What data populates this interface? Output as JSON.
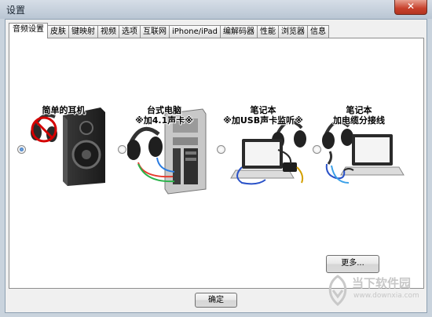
{
  "window": {
    "title": "设置",
    "close_glyph": "✕"
  },
  "tabs": [
    {
      "label": "音频设置",
      "active": true
    },
    {
      "label": "皮肤"
    },
    {
      "label": "键映射"
    },
    {
      "label": "视频"
    },
    {
      "label": "选项"
    },
    {
      "label": "互联网"
    },
    {
      "label": "iPhone/iPad"
    },
    {
      "label": "编解码器"
    },
    {
      "label": "性能"
    },
    {
      "label": "浏览器"
    },
    {
      "label": "信息"
    }
  ],
  "audio_options": [
    {
      "label": "简单的耳机",
      "selected": true,
      "icon": "headphone-speaker-icon"
    },
    {
      "label_line1": "台式电脑",
      "label_line2": "※加4.1声卡※",
      "selected": false,
      "icon": "desktop-pc-headphone-icon"
    },
    {
      "label_line1": "笔记本",
      "label_line2": "※加USB声卡监听※",
      "selected": false,
      "icon": "laptop-usb-headphone-icon"
    },
    {
      "label_line1": "笔记本",
      "label_line2": "加电缆分接线",
      "selected": false,
      "icon": "laptop-splitter-headphone-icon"
    }
  ],
  "more_button": "更多...",
  "ok_button": "确定",
  "watermark": {
    "name": "当下软件园",
    "url": "www.downxia.com"
  }
}
